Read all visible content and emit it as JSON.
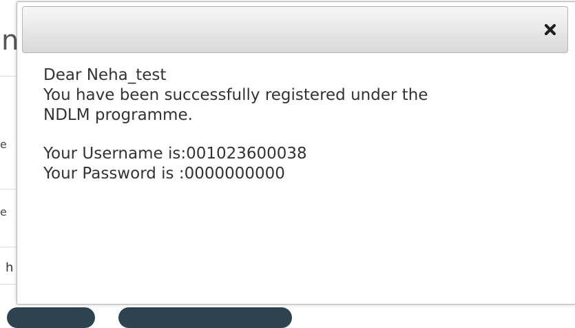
{
  "background": {
    "heading_fragment": "n",
    "fragment_1": "e",
    "fragment_2": "e",
    "fragment_3": "h"
  },
  "dialog": {
    "close_icon": "close-icon",
    "greeting": "Dear Neha_test",
    "message_line1": "You have been successfully registered under the",
    "message_line2": "NDLM programme.",
    "username_line": "Your Username is:001023600038",
    "password_line": "Your Password is :0000000000"
  },
  "colors": {
    "body_text": "#333333",
    "header_bar": "#dcdcdc",
    "background_button": "#2d4450"
  }
}
